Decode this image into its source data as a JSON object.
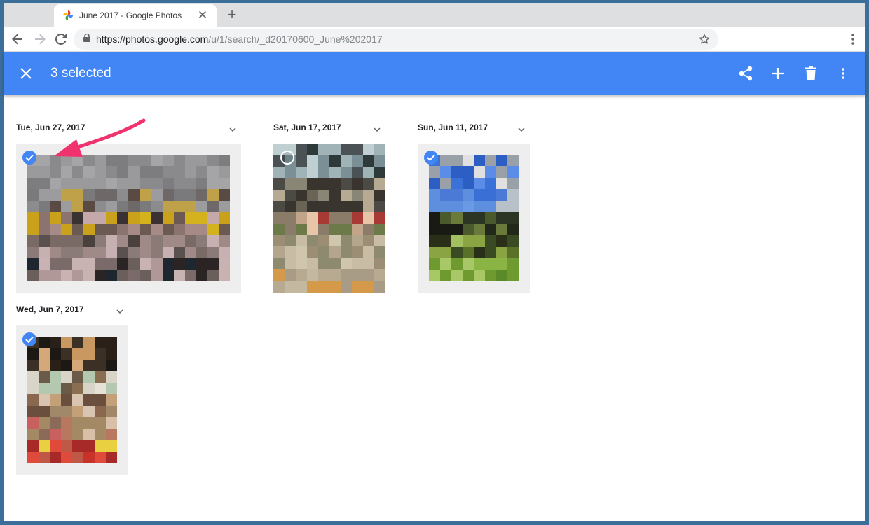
{
  "browser": {
    "tab_title": "June 2017 - Google Photos",
    "url_host": "https://photos.google.com",
    "url_path": "/u/1/search/_d20170600_June%202017",
    "icons": [
      "back-icon",
      "forward-icon",
      "reload-icon",
      "lock-icon",
      "star-icon",
      "kebab-menu-icon",
      "new-tab-icon",
      "close-tab-icon"
    ]
  },
  "appbar": {
    "selected_label": "3 selected",
    "color": "#4285f4",
    "actions": [
      "share-icon",
      "add-icon",
      "delete-icon",
      "more-icon"
    ]
  },
  "groups": [
    {
      "date": "Tue, Jun 27, 2017",
      "selected": true
    },
    {
      "date": "Sat, Jun 17, 2017",
      "selected": false
    },
    {
      "date": "Sun, Jun 11, 2017",
      "selected": true
    },
    {
      "date": "Wed, Jun 7, 2017",
      "selected": true
    }
  ],
  "colors": {
    "check_selected": "#4285f4",
    "annotation_arrow": "#f0336e",
    "frame_border": "#3b6e98"
  }
}
